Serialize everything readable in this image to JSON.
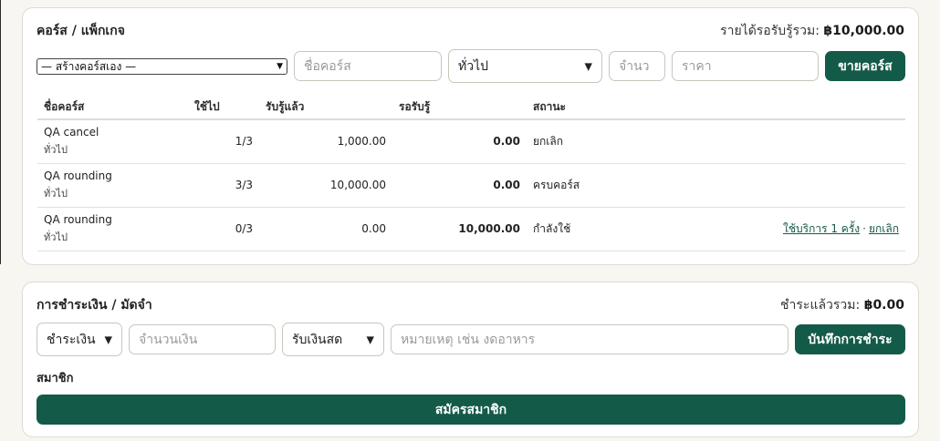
{
  "course": {
    "title": "คอร์ส / แพ็กเกจ",
    "summary_label": "รายได้รอรับรู้รวม:",
    "summary_value": "฿10,000.00",
    "template_select": "— สร้างคอร์สเอง —",
    "name_placeholder": "ชื่อคอร์ส",
    "category_value": "ทั่วไป",
    "qty_placeholder": "จำนว",
    "price_placeholder": "ราคา",
    "sell_button": "ขายคอร์ส",
    "columns": [
      "ชื่อคอร์ส",
      "ใช้ไป",
      "รับรู้แล้ว",
      "รอรับรู้",
      "สถานะ"
    ],
    "rows": [
      {
        "name": "QA cancel",
        "category": "ทั่วไป",
        "used": "1/3",
        "recognized": "1,000.00",
        "pending": "0.00",
        "status": "ยกเลิก"
      },
      {
        "name": "QA rounding",
        "category": "ทั่วไป",
        "used": "3/3",
        "recognized": "10,000.00",
        "pending": "0.00",
        "status": "ครบคอร์ส"
      },
      {
        "name": "QA rounding",
        "category": "ทั่วไป",
        "used": "0/3",
        "recognized": "0.00",
        "pending": "10,000.00",
        "status": "กำลังใช้",
        "action_use": "ใช้บริการ 1 ครั้ง",
        "action_sep": "·",
        "action_cancel": "ยกเลิก"
      }
    ]
  },
  "payment": {
    "title": "การชำระเงิน / มัดจำ",
    "summary_label": "ชำระแล้วรวม:",
    "summary_value": "฿0.00",
    "type_value": "ชำระเงิน",
    "amount_placeholder": "จำนวนเงิน",
    "method_value": "รับเงินสด",
    "note_placeholder": "หมายเหตุ เช่น งดอาหาร",
    "save_button": "บันทึกการชำระ",
    "member_label": "สมาชิก",
    "register_button": "สมัครสมาชิก"
  },
  "colors": {
    "primary": "#145a48",
    "border": "#dedbd2",
    "background": "#f7f6f1"
  }
}
